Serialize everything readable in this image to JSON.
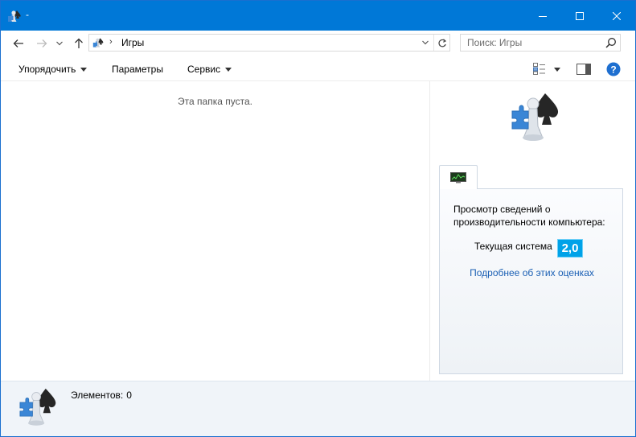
{
  "window": {
    "title": "-"
  },
  "navigation": {
    "back_icon": "arrow-left-icon",
    "forward_icon": "arrow-right-icon",
    "recent_icon": "chevron-down-icon",
    "up_icon": "arrow-up-icon"
  },
  "address": {
    "location": "Игры",
    "separator": "›"
  },
  "search": {
    "placeholder": "Поиск: Игры"
  },
  "commandbar": {
    "organize": "Упорядочить",
    "parameters": "Параметры",
    "service": "Сервис"
  },
  "content": {
    "empty_message": "Эта папка пуста."
  },
  "preview": {
    "panel_title": "Просмотр сведений о производительности компьютера:",
    "current_system_label": "Текущая система",
    "score": "2,0",
    "more_link": "Подробнее об этих оценках"
  },
  "details": {
    "items_label": "Элементов:",
    "items_count": "0"
  },
  "colors": {
    "titlebar": "#0078d7",
    "score_badge": "#00a2e8",
    "link": "#1a5fb4",
    "details_bg": "#f0f4f9"
  }
}
